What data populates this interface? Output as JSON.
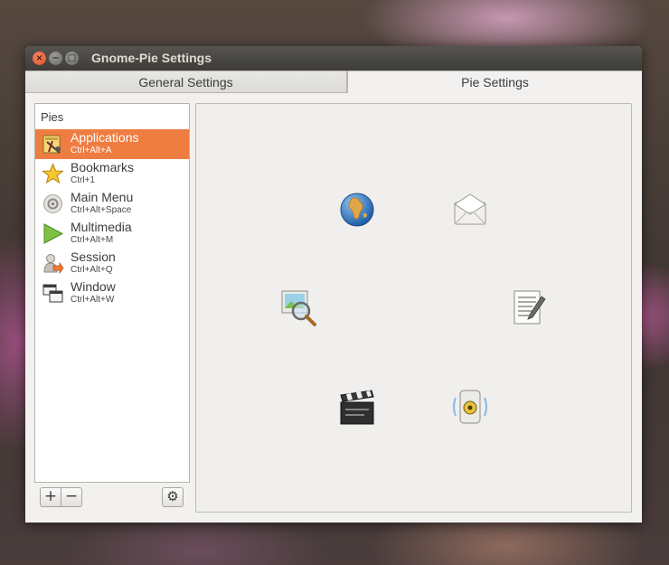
{
  "window": {
    "title": "Gnome-Pie Settings"
  },
  "window_controls": {
    "close": "×",
    "minimize": "−",
    "maximize": "□"
  },
  "tabs": [
    {
      "label": "General Settings",
      "active": false
    },
    {
      "label": "Pie Settings",
      "active": true
    }
  ],
  "sidebar": {
    "header": "Pies",
    "items": [
      {
        "name": "Applications",
        "shortcut": "Ctrl+Alt+A",
        "icon": "applications-icon",
        "selected": true
      },
      {
        "name": "Bookmarks",
        "shortcut": "Ctrl+1",
        "icon": "star-icon",
        "selected": false
      },
      {
        "name": "Main Menu",
        "shortcut": "Ctrl+Alt+Space",
        "icon": "main-menu-icon",
        "selected": false
      },
      {
        "name": "Multimedia",
        "shortcut": "Ctrl+Alt+M",
        "icon": "play-icon",
        "selected": false
      },
      {
        "name": "Session",
        "shortcut": "Ctrl+Alt+Q",
        "icon": "session-icon",
        "selected": false
      },
      {
        "name": "Window",
        "shortcut": "Ctrl+Alt+W",
        "icon": "window-icon",
        "selected": false
      }
    ]
  },
  "toolbar": {
    "add_label": "+",
    "remove_label": "−",
    "settings_label": "⚙"
  },
  "preview": {
    "slices": [
      {
        "icon": "web-browser-icon"
      },
      {
        "icon": "mail-icon"
      },
      {
        "icon": "text-editor-icon"
      },
      {
        "icon": "speaker-icon"
      },
      {
        "icon": "video-clapper-icon"
      },
      {
        "icon": "image-viewer-icon"
      }
    ]
  },
  "colors": {
    "selection": "#ee7d42",
    "titlebar": "#3e3d39",
    "close_button": "#df4b1e"
  }
}
